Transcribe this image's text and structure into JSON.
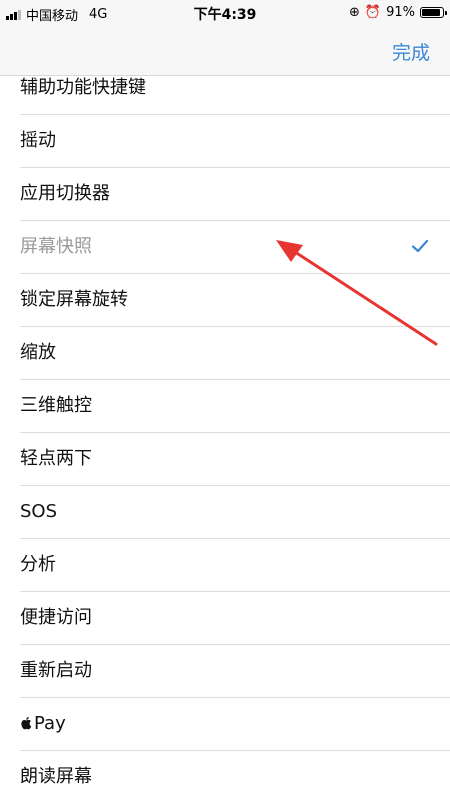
{
  "status_bar": {
    "carrier": "中国移动",
    "network": "4G",
    "time": "下午4:39",
    "battery": "91%",
    "battery_level": 0.91
  },
  "nav": {
    "done_label": "完成"
  },
  "list": {
    "items": [
      {
        "label": "辅助功能快捷键"
      },
      {
        "label": "摇动"
      },
      {
        "label": "应用切换器"
      },
      {
        "label": "屏幕快照",
        "disabled": true,
        "checked": true
      },
      {
        "label": "锁定屏幕旋转"
      },
      {
        "label": "缩放"
      },
      {
        "label": "三维触控"
      },
      {
        "label": "轻点两下"
      },
      {
        "label": "SOS"
      },
      {
        "label": "分析"
      },
      {
        "label": "便捷访问"
      },
      {
        "label": "重新启动"
      },
      {
        "label": "Pay"
      },
      {
        "label": "朗读屏幕"
      }
    ]
  },
  "colors": {
    "accent": "#3d87d6",
    "annotation_arrow": "#e8352f"
  }
}
